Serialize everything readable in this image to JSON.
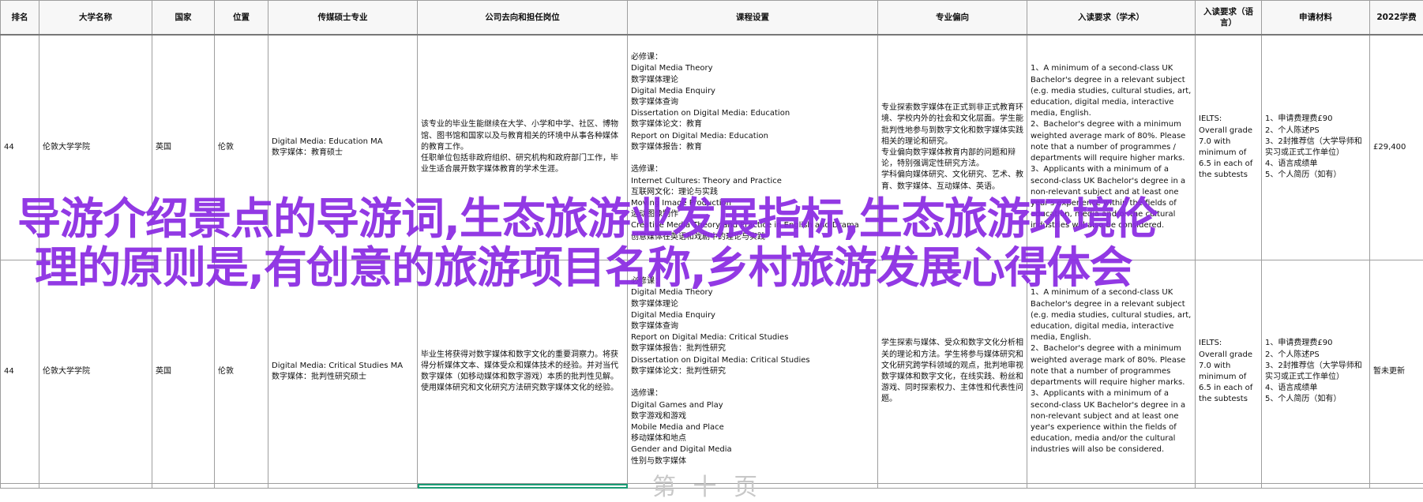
{
  "headers": [
    "排名",
    "大学名称",
    "国家",
    "位置",
    "传媒硕士专业",
    "公司去向和担任岗位",
    "课程设置",
    "专业偏向",
    "入读要求（学术）",
    "入读要求（语言）",
    "申请材料",
    "2022学费"
  ],
  "rows": [
    {
      "rank": "44",
      "university": "伦敦大学学院",
      "country": "英国",
      "location": "伦敦",
      "program": [
        "Digital Media: Education MA",
        "数字媒体：教育硕士"
      ],
      "careers": [
        "该专业的毕业生能继续在大学、小学和中学、社区、博物馆、图书馆和国家以及与教育相关的环境中从事各种媒体的教育工作。",
        "任职单位包括非政府组织、研究机构和政府部门工作，毕业生适合展开数字媒体教育的学术生涯。"
      ],
      "courses": [
        "必修课：",
        "Digital Media Theory",
        "数字媒体理论",
        "Digital Media Enquiry",
        "数字媒体查询",
        "Dissertation on Digital Media: Education",
        "数字媒体论文：教育",
        "Report on Digital Media: Education",
        "数字媒体报告：教育",
        "",
        "选修课：",
        "Internet Cultures: Theory and Practice",
        "互联网文化：理论与实践",
        "Moving Image Production",
        "运动图像制作",
        "Creative Media Theory and Practice in English and Drama",
        "创意媒体在英语和戏剧中的理论与实践"
      ],
      "focus": [
        "专业探索数字媒体在正式到非正式教育环境、学校内外的社会和文化层面。学生能批判性地参与到数字文化和数字媒体实践相关的理论和研究。",
        "专业偏向数字媒体教育内部的问题和辩论，特别强调定性研究方法。",
        "学科偏向媒体研究、文化研究、艺术、教育、数字媒体、互动媒体、英语。"
      ],
      "academic": [
        "1、A minimum of a second-class UK Bachelor's degree in a relevant subject (e.g. media studies, cultural studies, art, education, digital media, interactive media, English.",
        "2、Bachelor's degree with a minimum weighted average mark of 80%. Please note that a number of programmes / departments will require higher marks.",
        "3、Applicants with a minimum of a second-class UK Bachelor's degree in a non-relevant subject and at least one year's experience within the fields of education, media and/or the cultural industries will also be considered."
      ],
      "language": [
        "IELTS:",
        "Overall grade 7.0 with minimum of 6.5 in each of the subtests"
      ],
      "materials": [
        "1、申请费理费£90",
        "2、个人陈述PS",
        "3、2封推荐信（大学导师和实习或正式工作单位）",
        "4、语言成绩单",
        "5、个人简历（如有）"
      ],
      "fee": "£29,400"
    },
    {
      "rank": "44",
      "university": "伦敦大学学院",
      "country": "英国",
      "location": "伦敦",
      "program": [
        "Digital Media: Critical Studies MA",
        "数字媒体：批判性研究硕士"
      ],
      "careers": [
        "毕业生将获得对数字媒体和数字文化的重要洞察力。将获得分析媒体文本、媒体受众和媒体技术的经验。并对当代数字媒体（如移动媒体和数字游戏）本质的批判性见解。使用媒体研究和文化研究方法研究数字媒体文化的经验。"
      ],
      "courses": [
        "必修课：",
        "Digital Media Theory",
        "数字媒体理论",
        "Digital Media Enquiry",
        "数字媒体查询",
        "Report on Digital Media: Critical Studies",
        "数字媒体报告：批判性研究",
        "Dissertation on Digital Media: Critical Studies",
        "数字媒体论文：批判性研究",
        "",
        "选修课：",
        "Digital Games and Play",
        "数字游戏和游戏",
        "Mobile Media and Place",
        "移动媒体和地点",
        "Gender and Digital Media",
        "性别与数字媒体"
      ],
      "focus": [
        "学生探索与媒体、受众和数字文化分析相关的理论和方法。学生将参与媒体研究和文化研究跨学科领域的观点，批判地审视数字媒体和数字文化，在线实践、粉丝和游戏、同时探索权力、主体性和代表性问题。"
      ],
      "academic": [
        "1、A minimum of a second-class UK Bachelor's degree in a relevant subject (e.g. media studies, cultural studies, art, education, digital media, interactive media, English.",
        "2、Bachelor's degree with a minimum weighted average mark of 80%. Please note that a number of programmes departments will require higher marks.",
        "3、Applicants with a minimum of a second-class UK Bachelor's degree in a non-relevant subject and at least one year's experience within the fields of education, media and/or the cultural industries will also be considered."
      ],
      "language": [
        "IELTS:",
        "Overall grade 7.0 with minimum of 6.5 in each of the subtests"
      ],
      "materials": [
        "1、申请费理费£90",
        "2、个人陈述PS",
        "3、2封推荐信（大学导师和实习或正式工作单位）",
        "4、语言成绩单",
        "5、个人简历（如有）"
      ],
      "fee": "暂未更新"
    }
  ],
  "watermark": {
    "line1": "导游介绍景点的导游词,生态旅游业发展指标,生态旅游环境伦",
    "line2": "理的原则是,有创意的旅游项目名称,乡村旅游发展心得体会"
  },
  "peek_text": "第 十 页",
  "colors": {
    "watermark": "#8a2be2",
    "selection": "#1a9c74",
    "grid": "#9e9e9e"
  }
}
